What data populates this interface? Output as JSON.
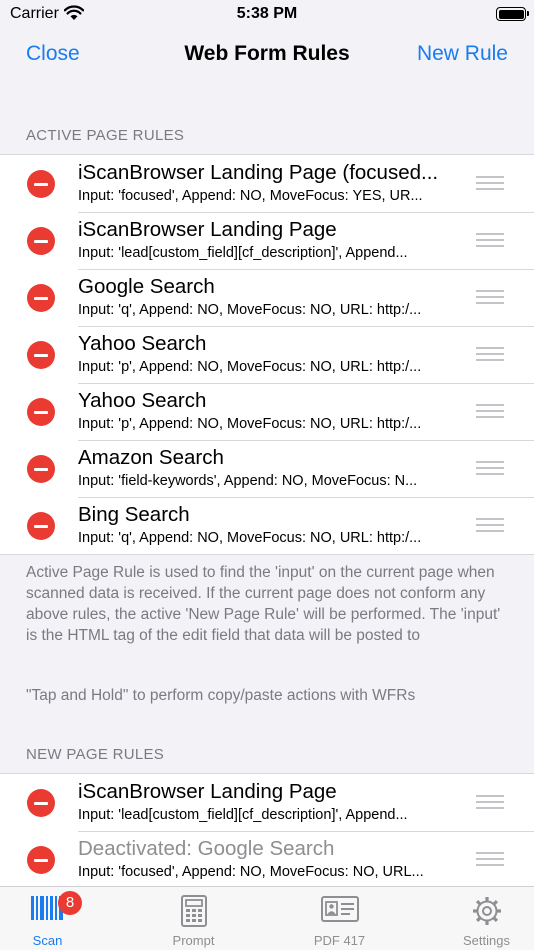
{
  "status": {
    "carrier": "Carrier",
    "time": "5:38 PM"
  },
  "nav": {
    "close_label": "Close",
    "title": "Web Form Rules",
    "new_rule_label": "New Rule"
  },
  "active_section": {
    "header": "ACTIVE PAGE RULES",
    "rules": [
      {
        "title": "iScanBrowser Landing Page (focused...",
        "detail": "Input: 'focused', Append: NO, MoveFocus: YES, UR..."
      },
      {
        "title": "iScanBrowser Landing Page",
        "detail": "Input: 'lead[custom_field][cf_description]', Append..."
      },
      {
        "title": "Google Search",
        "detail": "Input: 'q', Append: NO, MoveFocus: NO, URL: http:/..."
      },
      {
        "title": "Yahoo Search",
        "detail": "Input: 'p', Append: NO, MoveFocus: NO, URL: http:/..."
      },
      {
        "title": "Yahoo Search",
        "detail": "Input: 'p', Append: NO, MoveFocus: NO, URL: http:/..."
      },
      {
        "title": "Amazon Search",
        "detail": "Input: 'field-keywords', Append: NO, MoveFocus: N..."
      },
      {
        "title": "Bing Search",
        "detail": "Input: 'q', Append: NO, MoveFocus: NO, URL: http:/..."
      }
    ],
    "footer": "Active Page Rule is used to find the 'input' on the current page when scanned data is received. If the current page does not conform any above rules, the active 'New Page Rule' will be performed. The 'input' is the HTML tag of the edit field that data will be posted to",
    "footer_hint": "\"Tap and Hold\" to perform copy/paste actions with WFRs"
  },
  "new_section": {
    "header": "NEW PAGE RULES",
    "rules": [
      {
        "title": "iScanBrowser Landing Page",
        "detail": "Input: 'lead[custom_field][cf_description]', Append..."
      },
      {
        "title": "Deactivated: Google Search",
        "detail": "Input: 'focused', Append: NO, MoveFocus: NO, URL..."
      }
    ]
  },
  "tabs": [
    {
      "label": "Scan",
      "icon": "barcode-icon",
      "badge": "8",
      "active": true
    },
    {
      "label": "Prompt",
      "icon": "calculator-icon",
      "active": false
    },
    {
      "label": "PDF 417",
      "icon": "id-card-icon",
      "active": false
    },
    {
      "label": "Settings",
      "icon": "gear-icon",
      "active": false
    }
  ],
  "colors": {
    "accent": "#1a7cf0",
    "delete": "#ea3b33",
    "secondary_text": "#7a7a80",
    "background": "#f2f2f7"
  }
}
